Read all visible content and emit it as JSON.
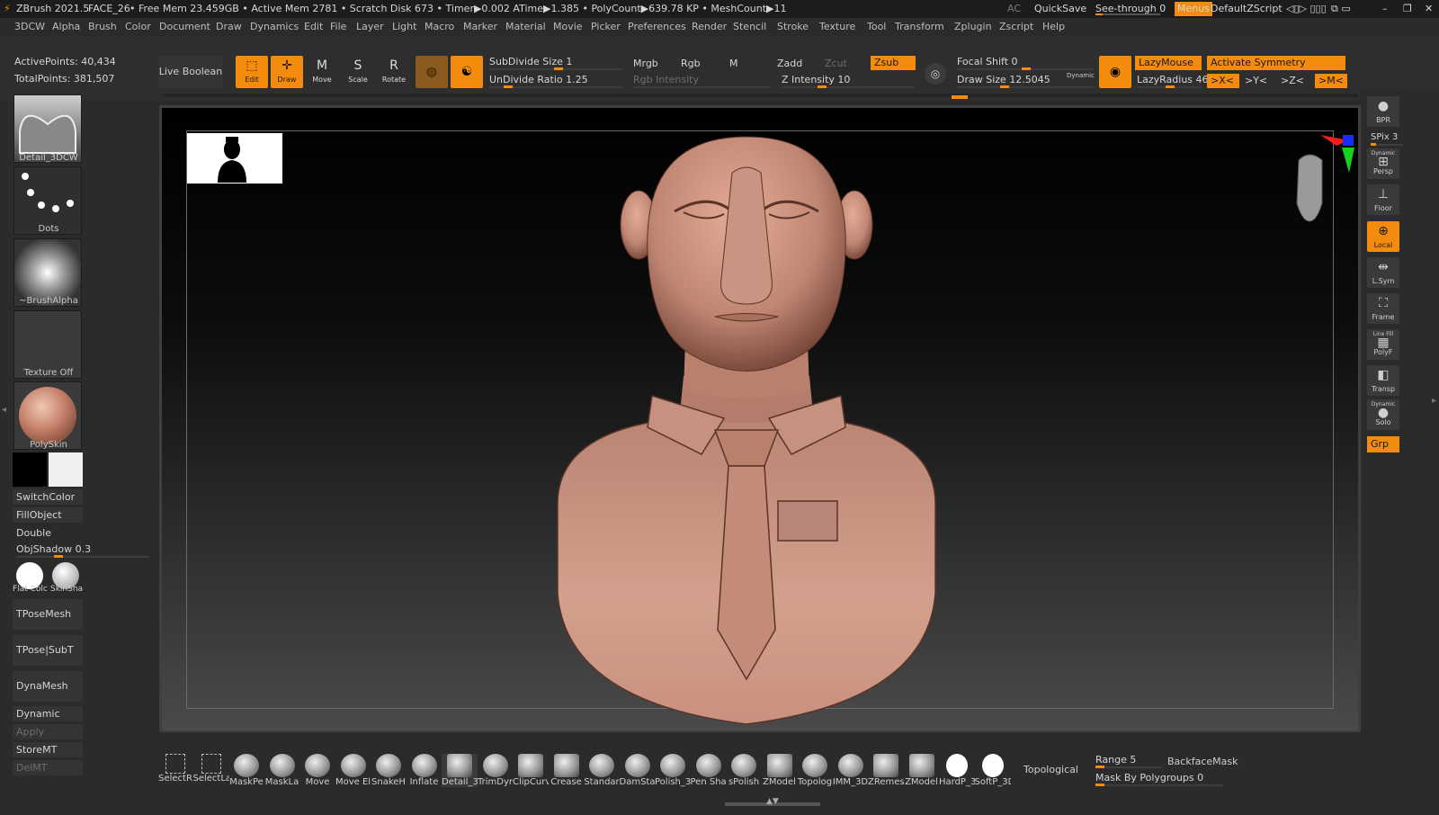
{
  "titlebar": {
    "app": "ZBrush 2021.5",
    "file": "FACE_26",
    "stats": "• Free Mem 23.459GB • Active Mem 2781 • Scratch Disk 673 • Timer▶0.002 ATime▶1.385 • PolyCount▶639.78 KP • MeshCount▶11",
    "ac": "AC",
    "quicksave": "QuickSave",
    "seethrough": "See-through  0",
    "menus": "Menus",
    "script": "DefaultZScript"
  },
  "menu": [
    "3DCW",
    "Alpha",
    "Brush",
    "Color",
    "Document",
    "Draw",
    "Dynamics",
    "Edit",
    "File",
    "Layer",
    "Light",
    "Macro",
    "Marker",
    "Material",
    "Movie",
    "Picker",
    "Preferences",
    "Render",
    "Stencil",
    "Stroke",
    "Texture",
    "Tool",
    "Transform",
    "Zplugin",
    "Zscript",
    "Help"
  ],
  "stats": {
    "active": "ActivePoints: 40,434",
    "total": "TotalPoints: 381,507"
  },
  "shelf": {
    "live_boolean": "Live Boolean",
    "edit": "Edit",
    "draw": "Draw",
    "move": "Move",
    "scale": "Scale",
    "rotate": "Rotate",
    "subdivide": {
      "label": "SubDivide Size",
      "value": "1"
    },
    "undivide": {
      "label": "UnDivide Ratio",
      "value": "1.25"
    },
    "mrgb": "Mrgb",
    "rgb": "Rgb",
    "m": "M",
    "rgb_intensity": "Rgb Intensity",
    "zadd": "Zadd",
    "zcut": "Zcut",
    "zsub": "Zsub",
    "z_intensity": {
      "label": "Z Intensity",
      "value": "10"
    },
    "focal_shift": {
      "label": "Focal Shift",
      "value": "0"
    },
    "draw_size": {
      "label": "Draw Size",
      "value": "12.5045"
    },
    "dynamic": "Dynamic",
    "lazymouse": "LazyMouse",
    "lazyradius": {
      "label": "LazyRadius",
      "value": "46"
    },
    "activate_symmetry": "Activate Symmetry",
    "sym_x": ">X<",
    "sym_y": ">Y<",
    "sym_z": ">Z<",
    "sym_m": ">M<"
  },
  "left": {
    "thumbs": [
      "Detail_3DCW",
      "Dots",
      "~BrushAlpha",
      "Texture Off",
      "PolySkin"
    ],
    "switchcolor": "SwitchColor",
    "fillobject": "FillObject",
    "double": "Double",
    "objshadow": {
      "label": "ObjShadow",
      "value": "0.3"
    },
    "mats": [
      "Flat Colc",
      "SkinSha"
    ],
    "tposemesh": "TPoseMesh",
    "tposesubt": "TPose|SubT",
    "dynamesh": "DynaMesh",
    "dynamic": "Dynamic",
    "apply": "Apply",
    "storemt": "StoreMT",
    "delmt": "DelMT"
  },
  "right": {
    "bpr": "BPR",
    "spix": "SPix 3",
    "persp_top": "Dynamic",
    "persp": "Persp",
    "floor": "Floor",
    "local": "Local",
    "lsym": "L.Sym",
    "frame": "Frame",
    "linefill": "Line Fill",
    "polyf": "PolyF",
    "transp": "Transp",
    "solo_top": "Dynamic",
    "solo": "Solo",
    "grp": "Grp"
  },
  "brushes": [
    "SelectR",
    "SelectLa",
    "MaskPe",
    "MaskLa",
    "Move",
    "Move El",
    "SnakeH",
    "Inflate",
    "Detail_3",
    "TrimDyr",
    "ClipCurv",
    "Crease",
    "Standar",
    "DamSta",
    "Polish_3",
    "Pen Sha",
    "sPolish",
    "ZModel",
    "Topolog",
    "IMM_3D",
    "ZRemes",
    "ZModel",
    "HardP_3",
    "SoftP_3D"
  ],
  "bottom": {
    "topological": "Topological",
    "range": {
      "label": "Range",
      "value": "5"
    },
    "backfacemask": "BackfaceMask",
    "maskbypolygroups": {
      "label": "Mask By Polygroups",
      "value": "0"
    }
  },
  "colors": {
    "accent": "#f28b0e",
    "skin": "#c9917f"
  }
}
